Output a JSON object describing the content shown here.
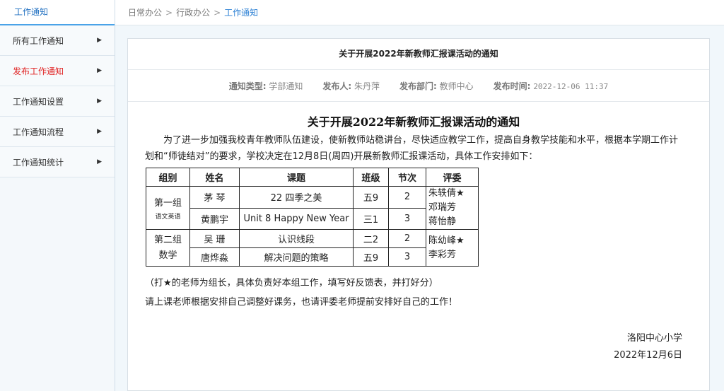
{
  "sidebar": {
    "title": "工作通知",
    "items": [
      {
        "label": "所有工作通知",
        "arrow": "▶"
      },
      {
        "label": "发布工作通知",
        "arrow": "▶"
      },
      {
        "label": "工作通知设置",
        "arrow": "▶"
      },
      {
        "label": "工作通知流程",
        "arrow": "▶"
      },
      {
        "label": "工作通知统计",
        "arrow": "▶"
      }
    ]
  },
  "breadcrumb": {
    "items": [
      "日常办公",
      "行政办公",
      "工作通知"
    ],
    "separator": ">"
  },
  "notice": {
    "header_title": "关于开展2022年新教师汇报课活动的通知",
    "meta": {
      "type_label": "通知类型:",
      "type_value": "学部通知",
      "publisher_label": "发布人:",
      "publisher_value": "朱丹萍",
      "dept_label": "发布部门:",
      "dept_value": "教师中心",
      "time_label": "发布时间:",
      "time_value": "2022-12-06 11:37"
    },
    "doc_title": "关于开展2022年新教师汇报课活动的通知",
    "paragraph": "为了进一步加强我校青年教师队伍建设，使新教师站稳讲台，尽快适应教学工作，提高自身教学技能和水平，根据本学期工作计划和“师徒结对”的要求，学校决定在12月8日(周四)开展新教师汇报课活动，具体工作安排如下：",
    "table": {
      "headers": [
        "组别",
        "姓名",
        "课题",
        "班级",
        "节次",
        "评委"
      ],
      "group1": {
        "name": "第一组",
        "note": "语文英语"
      },
      "group2": {
        "name": "第二组",
        "subject": "数学"
      },
      "rows": [
        {
          "name": "茅  琴",
          "topic": "22 四季之美",
          "class": "五9",
          "period": "2"
        },
        {
          "name": "黄鹏宇",
          "topic": "Unit 8 Happy New Year",
          "class": "三1",
          "period": "3"
        },
        {
          "name": "吴  珊",
          "topic": "认识线段",
          "class": "二2",
          "period": "2"
        },
        {
          "name": "唐烨淼",
          "topic": "解决问题的策略",
          "class": "五9",
          "period": "3"
        }
      ],
      "judges1": [
        "朱轶倩★",
        "邓瑞芳",
        "蒋怡静"
      ],
      "judges2": [
        "陈幼峰★",
        "李彩芳"
      ]
    },
    "note": "（打★的老师为组长，具体负责好本组工作，填写好反馈表，并打好分）",
    "note2": "请上课老师根据安排自己调整好课务，也请评委老师提前安排好自己的工作！",
    "signature": "洛阳中心小学",
    "date": "2022年12月6日"
  }
}
